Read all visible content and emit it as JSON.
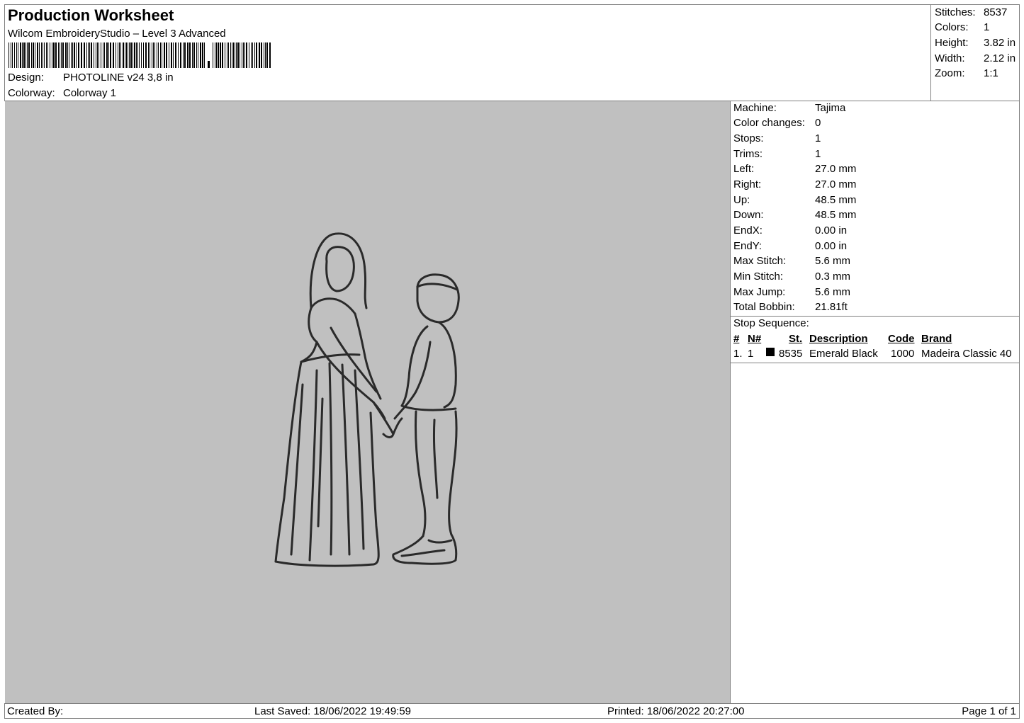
{
  "header": {
    "title": "Production Worksheet",
    "subtitle": "Wilcom EmbroideryStudio – Level 3 Advanced",
    "design_label": "Design:",
    "design_value": "PHOTOLINE v24 3,8 in",
    "colorway_label": "Colorway:",
    "colorway_value": "Colorway 1"
  },
  "summary": [
    {
      "label": "Stitches:",
      "value": "8537"
    },
    {
      "label": "Colors:",
      "value": "1"
    },
    {
      "label": "Height:",
      "value": "3.82 in"
    },
    {
      "label": "Width:",
      "value": "2.12 in"
    },
    {
      "label": "Zoom:",
      "value": "1:1"
    }
  ],
  "machine_info": [
    {
      "label": "Machine:",
      "value": "Tajima"
    },
    {
      "label": "Color changes:",
      "value": "0"
    },
    {
      "label": "Stops:",
      "value": "1"
    },
    {
      "label": "Trims:",
      "value": "1"
    },
    {
      "label": "Left:",
      "value": "27.0 mm"
    },
    {
      "label": "Right:",
      "value": "27.0 mm"
    },
    {
      "label": "Up:",
      "value": "48.5 mm"
    },
    {
      "label": "Down:",
      "value": "48.5 mm"
    },
    {
      "label": "EndX:",
      "value": "0.00 in"
    },
    {
      "label": "EndY:",
      "value": "0.00 in"
    },
    {
      "label": "Max Stitch:",
      "value": "5.6 mm"
    },
    {
      "label": "Min Stitch:",
      "value": "0.3 mm"
    },
    {
      "label": "Max Jump:",
      "value": "5.6 mm"
    },
    {
      "label": "Total Bobbin:",
      "value": "21.81ft"
    }
  ],
  "stop_sequence": {
    "title": "Stop Sequence:",
    "columns": [
      "#",
      "N#",
      "St.",
      "Description",
      "Code",
      "Brand"
    ],
    "rows": [
      {
        "index": "1.",
        "needle": "1",
        "swatch_color": "#000000",
        "stitches": "8535",
        "description": "Emerald Black",
        "code": "1000",
        "brand": "Madeira Classic 40"
      }
    ]
  },
  "footer": {
    "created_by": "Created By:",
    "last_saved": "Last Saved: 18/06/2022 19:49:59",
    "printed": "Printed: 18/06/2022 20:27:00",
    "page": "Page 1 of 1"
  },
  "colors": {
    "preview_background": "#c0c0c0",
    "stitch_color": "#2a2a2a",
    "border": "#808080"
  }
}
